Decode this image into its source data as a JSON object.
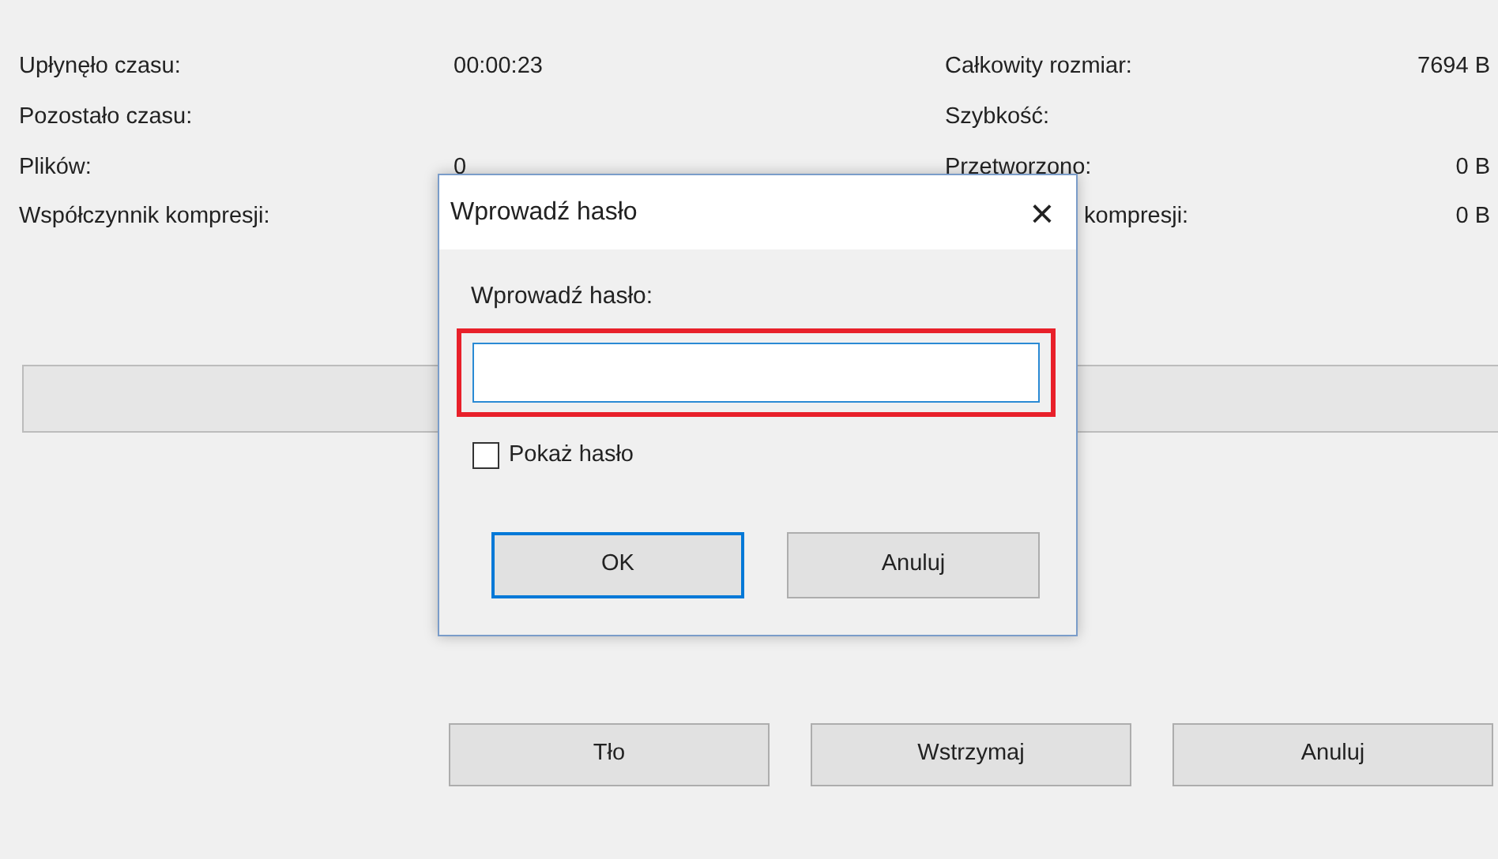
{
  "stats_left": [
    {
      "label": "Upłynęło czasu:",
      "value": "00:00:23"
    },
    {
      "label": "Pozostało czasu:"
    },
    {
      "label": "Plików:",
      "value": "0"
    },
    {
      "label": "Współczynnik kompresji:"
    }
  ],
  "stats_right": [
    {
      "label": "Całkowity rozmiar:",
      "value": "7694 B"
    },
    {
      "label": "Szybkość:"
    },
    {
      "label": "Przetworzono:",
      "value": "0 B"
    },
    {
      "label": "kompresji:",
      "value": "0 B",
      "partial": true
    }
  ],
  "progress": {
    "level": 0
  },
  "buttons": [
    "Tło",
    "Wstrzymaj",
    "Anuluj"
  ],
  "dialog": {
    "title": "Wprowadź hasło",
    "close": "×",
    "field_label": "Wprowadź hasło:",
    "field": {
      "highlighted": true
    },
    "checkbox": {
      "label": "Pokaż hasło",
      "checked": false
    },
    "buttons": [
      {
        "label": "OK",
        "default": true
      },
      {
        "label": "Anuluj",
        "default": false
      }
    ]
  }
}
